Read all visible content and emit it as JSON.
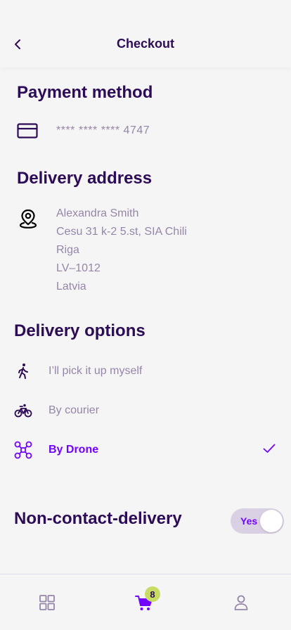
{
  "header": {
    "title": "Checkout",
    "back_icon": "chevron-left-icon"
  },
  "payment": {
    "title": "Payment method",
    "card_number": "****  ****  ****  4747",
    "icon": "credit-card-icon"
  },
  "delivery_address": {
    "title": "Delivery address",
    "icon": "location-pin-icon",
    "lines": [
      "Alexandra Smith",
      "Cesu 31 k-2 5.st, SIA Chili",
      "Riga",
      "LV–1012",
      "Latvia"
    ]
  },
  "delivery_options": {
    "title": "Delivery options",
    "items": [
      {
        "label": "I’ll pick it up myself",
        "icon": "walking-person-icon",
        "selected": false
      },
      {
        "label": "By courier",
        "icon": "bicycle-icon",
        "selected": false
      },
      {
        "label": "By Drone",
        "icon": "drone-icon",
        "selected": true
      }
    ]
  },
  "non_contact": {
    "title": "Non-contact-delivery",
    "toggle_label": "Yes",
    "enabled": true
  },
  "tabbar": {
    "items": [
      {
        "name": "grid-icon"
      },
      {
        "name": "cart-icon",
        "badge": "8"
      },
      {
        "name": "user-icon"
      }
    ]
  },
  "colors": {
    "primary_text": "#2d0c57",
    "secondary_text": "#9586a8",
    "accent": "#7203ff",
    "badge": "#c8db63",
    "background": "#f6f5f5"
  }
}
